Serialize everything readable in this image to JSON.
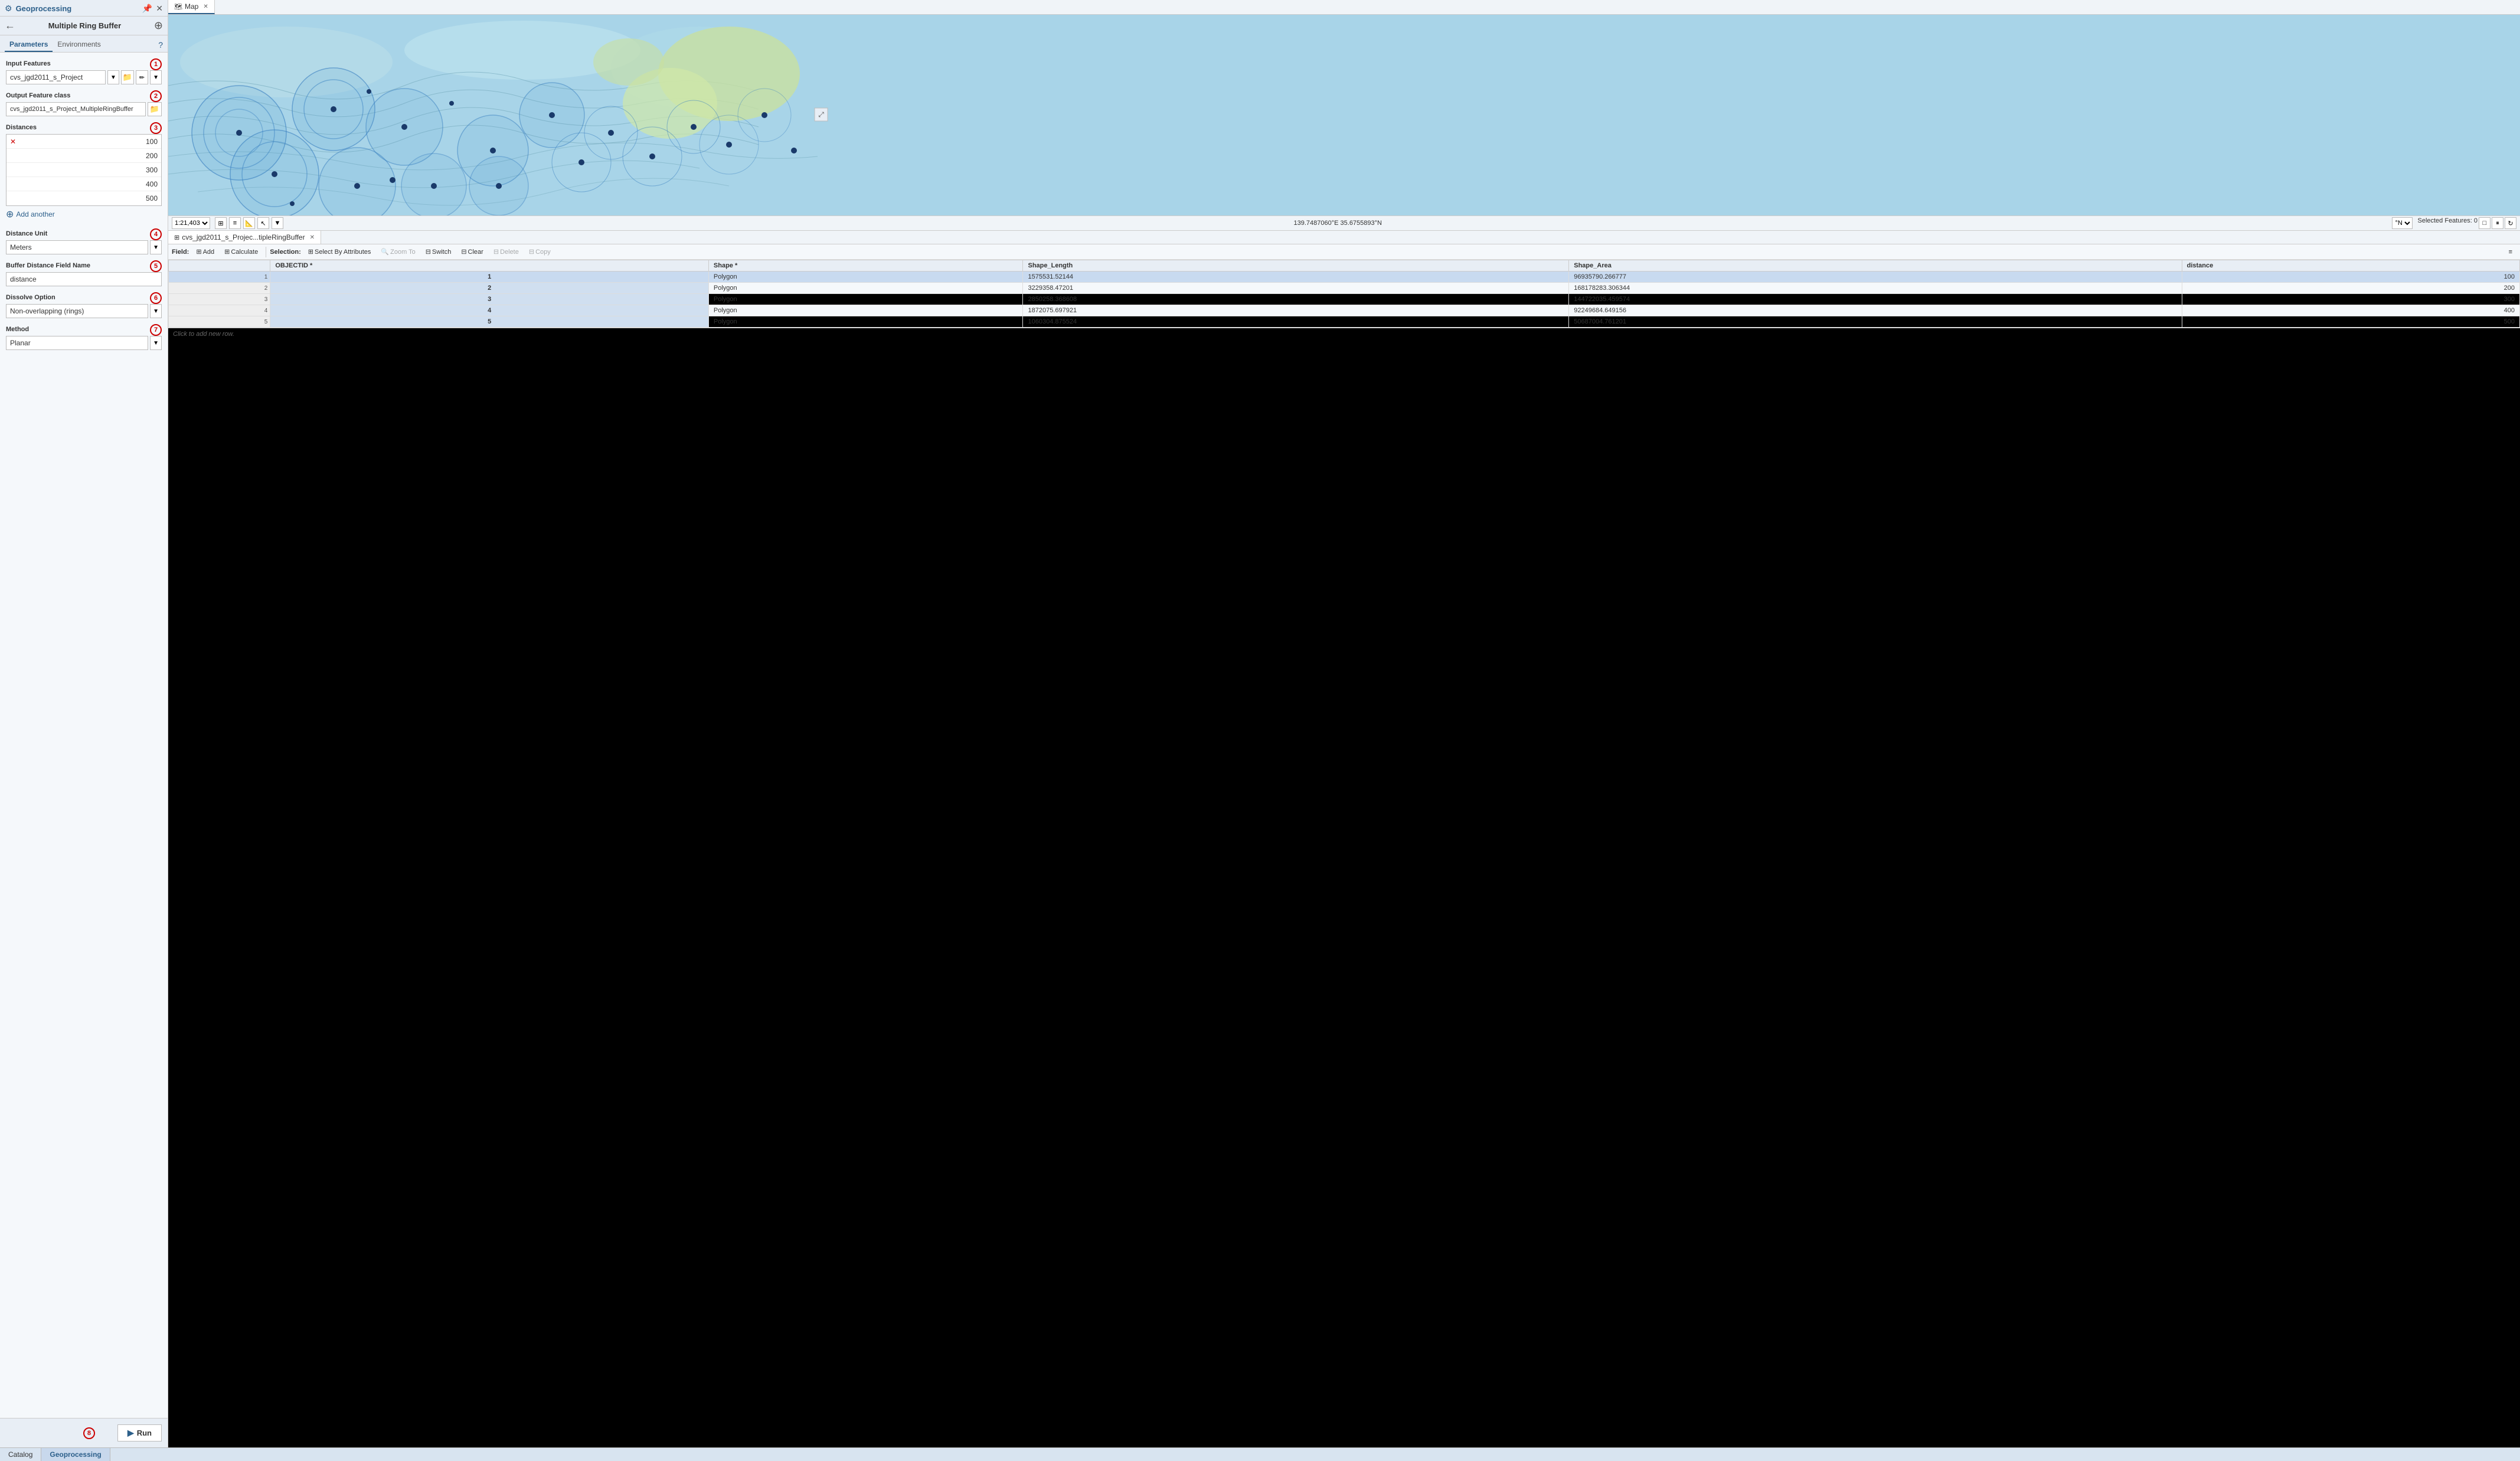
{
  "geoprocessing": {
    "title": "Geoprocessing",
    "panel_title": "Multiple Ring Buffer",
    "tabs": [
      "Parameters",
      "Environments"
    ],
    "active_tab": "Parameters",
    "fields": {
      "input_features_label": "Input Features",
      "input_features_value": "cvs_jgd2011_s_Project",
      "output_feature_class_label": "Output Feature class",
      "output_feature_class_value": "cvs_jgd2011_s_Project_MultipleRingBuffer",
      "distances_label": "Distances",
      "distances": [
        {
          "value": "100",
          "has_delete": true
        },
        {
          "value": "200",
          "has_delete": false
        },
        {
          "value": "300",
          "has_delete": false
        },
        {
          "value": "400",
          "has_delete": false
        },
        {
          "value": "500",
          "has_delete": false
        }
      ],
      "add_another_label": "Add another",
      "distance_unit_label": "Distance Unit",
      "distance_unit_value": "Meters",
      "buffer_distance_field_label": "Buffer Distance Field Name",
      "buffer_distance_field_value": "distance",
      "dissolve_option_label": "Dissolve Option",
      "dissolve_option_value": "Non-overlapping (rings)",
      "method_label": "Method",
      "method_value": "Planar"
    },
    "run_button": "Run",
    "badges": {
      "b1": "1",
      "b2": "2",
      "b3": "3",
      "b4": "4",
      "b5": "5",
      "b6": "6",
      "b7": "7",
      "b8": "8"
    }
  },
  "map": {
    "tab_label": "Map",
    "scale": "1:21,403",
    "coordinates": "139.7487060°E 35.6755893°N",
    "selected_features": "Selected Features: 0"
  },
  "table": {
    "tab_label": "cvs_jgd2011_s_Projec...tipleRingBuffer",
    "toolbar": {
      "field_label": "Field:",
      "add_label": "Add",
      "calculate_label": "Calculate",
      "selection_label": "Selection:",
      "select_by_attributes_label": "Select By Attributes",
      "zoom_to_label": "Zoom To",
      "switch_label": "Switch",
      "clear_label": "Clear",
      "delete_label": "Delete",
      "copy_label": "Copy"
    },
    "columns": [
      "",
      "OBJECTID *",
      "Shape *",
      "Shape_Length",
      "Shape_Area",
      "distance"
    ],
    "rows": [
      {
        "row_num": "1",
        "objectid": "1",
        "shape": "Polygon",
        "shape_length": "1575531.52144",
        "shape_area": "96935790.266777",
        "distance": "100"
      },
      {
        "row_num": "2",
        "objectid": "2",
        "shape": "Polygon",
        "shape_length": "3229358.47201",
        "shape_area": "168178283.306344",
        "distance": "200"
      },
      {
        "row_num": "3",
        "objectid": "3",
        "shape": "Polygon",
        "shape_length": "2850258.368608",
        "shape_area": "144722035.459574",
        "distance": "300"
      },
      {
        "row_num": "4",
        "objectid": "4",
        "shape": "Polygon",
        "shape_length": "1872075.697921",
        "shape_area": "92249684.649156",
        "distance": "400"
      },
      {
        "row_num": "5",
        "objectid": "5",
        "shape": "Polygon",
        "shape_length": "1060304.875524",
        "shape_area": "50687004.761201",
        "distance": "500"
      }
    ],
    "add_row_hint": "Click to add new row."
  },
  "bottom_tabs": [
    "Catalog",
    "Geoprocessing"
  ],
  "active_bottom_tab": "Geoprocessing",
  "colors": {
    "accent_blue": "#2c5f8a",
    "badge_red": "#c00",
    "selected_row": "#c8daf0"
  }
}
